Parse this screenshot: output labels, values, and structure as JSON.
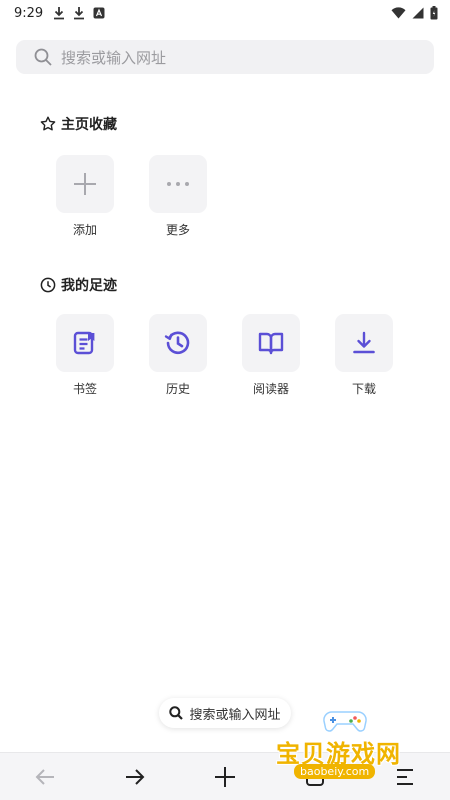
{
  "status_bar": {
    "time": "9:29"
  },
  "search": {
    "placeholder": "搜索或输入网址"
  },
  "favorites": {
    "title": "主页收藏",
    "items": [
      {
        "label": "添加",
        "icon": "plus-icon"
      },
      {
        "label": "更多",
        "icon": "more-dots-icon"
      }
    ]
  },
  "traces": {
    "title": "我的足迹",
    "items": [
      {
        "label": "书签",
        "icon": "bookmark-icon"
      },
      {
        "label": "历史",
        "icon": "history-icon"
      },
      {
        "label": "阅读器",
        "icon": "book-open-icon"
      },
      {
        "label": "下载",
        "icon": "download-icon"
      }
    ]
  },
  "floating_search": {
    "label": "搜索或输入网址"
  },
  "toolbar": {
    "items": [
      "back-arrow-icon",
      "forward-arrow-icon",
      "new-tab-plus-icon",
      "tabs-icon",
      "menu-icon"
    ]
  },
  "watermark": {
    "text": "宝贝游戏网",
    "url": "baobeiy.com"
  },
  "colors": {
    "accent": "#5b4fd6",
    "tile_bg": "#f3f3f5",
    "search_bg": "#f1f1f3",
    "watermark": "#f0b400"
  }
}
